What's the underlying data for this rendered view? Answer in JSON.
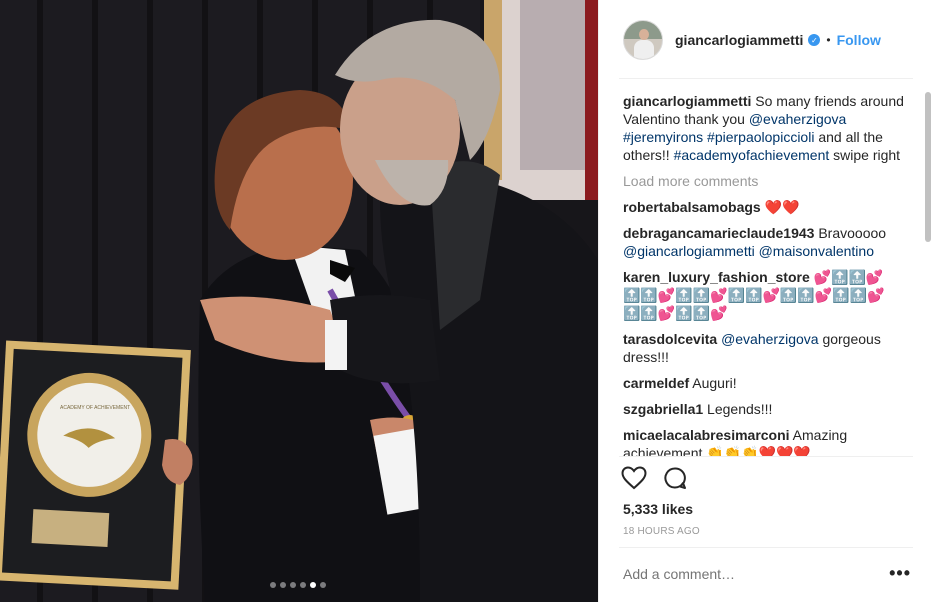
{
  "post": {
    "username": "giancarlogiammetti",
    "follow_label": "Follow",
    "bullet": "•",
    "caption": {
      "user": "giancarlogiammetti",
      "text_1": " So many friends around Valentino thank you ",
      "mention_1": "@evaherzigova",
      "space_1": " ",
      "hashtag_1": "#jeremyirons",
      "space_2": " ",
      "hashtag_2": "#pierpaolopiccioli",
      "text_2": " and all the others!! ",
      "hashtag_3": "#academyofachievement",
      "text_3": " swipe right"
    },
    "load_more": "Load more comments",
    "comments": [
      {
        "user": "robertabalsamobags",
        "text": " ❤️❤️"
      },
      {
        "user": "debragancamarieclaude1943",
        "text": " Bravooooo ",
        "tag": "@giancarlogiammetti @maisonvalentino"
      },
      {
        "user": "karen_luxury_fashion_store",
        "text": " 💕🔝🔝💕🔝🔝💕🔝🔝💕🔝🔝💕🔝🔝💕🔝🔝💕🔝🔝💕🔝🔝💕"
      },
      {
        "user": "tarasdolcevita",
        "tag": "@evaherzigova",
        "text": " gorgeous dress!!!"
      },
      {
        "user": "carmeldef",
        "text": " Auguri!"
      },
      {
        "user": "szgabriella1",
        "text": " Legends!!!"
      },
      {
        "user": "micaelacalabresimarconi",
        "text": " Amazing achievement 👏👏👏❤️❤️❤️"
      }
    ],
    "likes": "5,333 likes",
    "timestamp": "18 HOURS AGO",
    "add_comment_placeholder": "Add a comment…",
    "more_label": "•••",
    "verified_check": "✓"
  },
  "photo": {
    "plaque_text": "ACADEMY OF ACHIEVEMENT"
  },
  "carousel": {
    "count": 6,
    "active_index": 4
  },
  "colors": {
    "accent": "#3897f0",
    "link": "#003569",
    "muted": "#999999",
    "text": "#262626"
  },
  "icons": [
    "heart-icon",
    "comment-icon",
    "verified-icon",
    "more-icon"
  ]
}
